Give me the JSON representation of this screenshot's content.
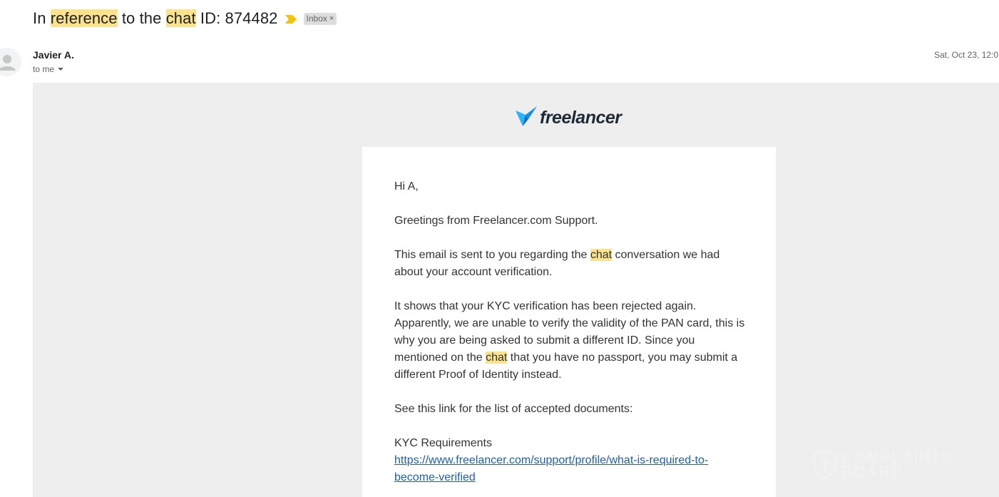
{
  "subject": {
    "parts": [
      {
        "text": "In ",
        "highlight": false
      },
      {
        "text": "reference",
        "highlight": true
      },
      {
        "text": " to the ",
        "highlight": false
      },
      {
        "text": "chat",
        "highlight": true
      },
      {
        "text": " ID: 874482",
        "highlight": false
      }
    ],
    "importance_icon": "importance-marker-icon",
    "label": "Inbox",
    "label_remove": "×"
  },
  "message": {
    "sender_name": "Javier A.",
    "recipient": "to me",
    "date": "Sat, Oct 23, 12:0"
  },
  "email": {
    "brand_name": "freelancer",
    "greeting": "Hi A,",
    "intro": "Greetings from Freelancer.com Support.",
    "para1_before": "This email is sent to you regarding the ",
    "para1_highlight": "chat",
    "para1_after": " conversation we had about your account verification.",
    "para2_before": "It shows that your KYC verification has been rejected again. Apparently, we are unable to verify the validity of the PAN card, this is why you are being asked to submit a different ID. Since you mentioned on the ",
    "para2_highlight": "chat",
    "para2_after": " that you have no passport, you may submit a different Proof of Identity instead.",
    "para3": "See this link for the list of accepted documents:",
    "link_title": "KYC Requirements",
    "link_url_line1": "https://www.freelancer.com/support/profile/what-is-required-to-",
    "link_url_line2": "become-verified"
  },
  "watermark": {
    "line1": "COMPLAINTS",
    "line2": "BOARD",
    "tagline": "CONSUMER REVIEWS"
  },
  "colors": {
    "highlight": "#fbe38e",
    "importance": "#f4c20d",
    "link": "#1f5fae",
    "body_bg": "#eeeeee",
    "brand_bird": "#29b2fe"
  }
}
